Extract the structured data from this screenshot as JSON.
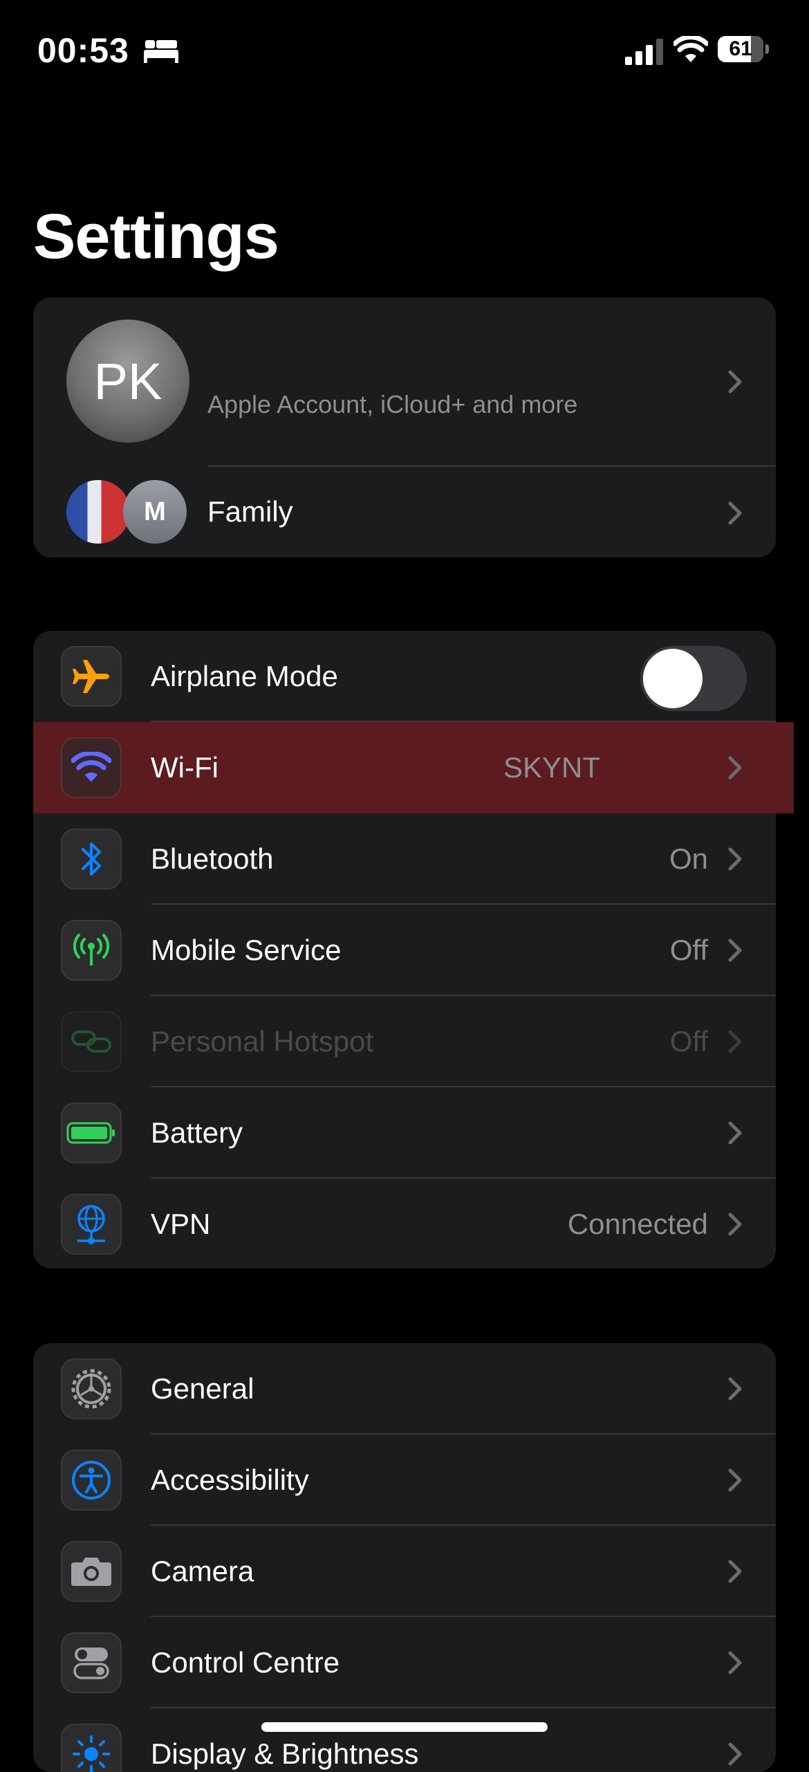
{
  "status_bar": {
    "time": "00:53",
    "battery_level": "61",
    "icons": [
      "bed-icon",
      "cellular-signal-icon",
      "wifi-icon",
      "battery-icon"
    ]
  },
  "title": "Settings",
  "account": {
    "initials": "PK",
    "subtitle": "Apple Account, iCloud+ and more",
    "family_label": "Family",
    "family_member_initial": "M"
  },
  "connectivity": [
    {
      "label": "Airplane Mode",
      "icon": "airplane-icon",
      "toggle": false
    },
    {
      "label": "Wi-Fi",
      "value": "SKYNT",
      "icon": "wifi-icon"
    },
    {
      "label": "Bluetooth",
      "value": "On",
      "icon": "bluetooth-icon"
    },
    {
      "label": "Mobile Service",
      "value": "Off",
      "icon": "antenna-icon"
    },
    {
      "label": "Personal Hotspot",
      "value": "Off",
      "icon": "link-icon"
    },
    {
      "label": "Battery",
      "value": "",
      "icon": "battery-icon"
    },
    {
      "label": "VPN",
      "value": "Connected",
      "icon": "globe-network-icon"
    }
  ],
  "system": [
    {
      "label": "General",
      "icon": "gear-icon"
    },
    {
      "label": "Accessibility",
      "icon": "accessibility-icon"
    },
    {
      "label": "Camera",
      "icon": "camera-icon"
    },
    {
      "label": "Control Centre",
      "icon": "switches-icon"
    },
    {
      "label": "Display & Brightness",
      "icon": "sun-icon"
    }
  ],
  "colors": {
    "accent_highlight": "#5b1b1f",
    "airplane": "#ff9f0a",
    "wifi": "#5e6bff",
    "bluetooth": "#0a84ff",
    "mobile": "#30d158",
    "battery": "#30d158",
    "vpn": "#0a84ff",
    "accessibility": "#0a84ff"
  }
}
